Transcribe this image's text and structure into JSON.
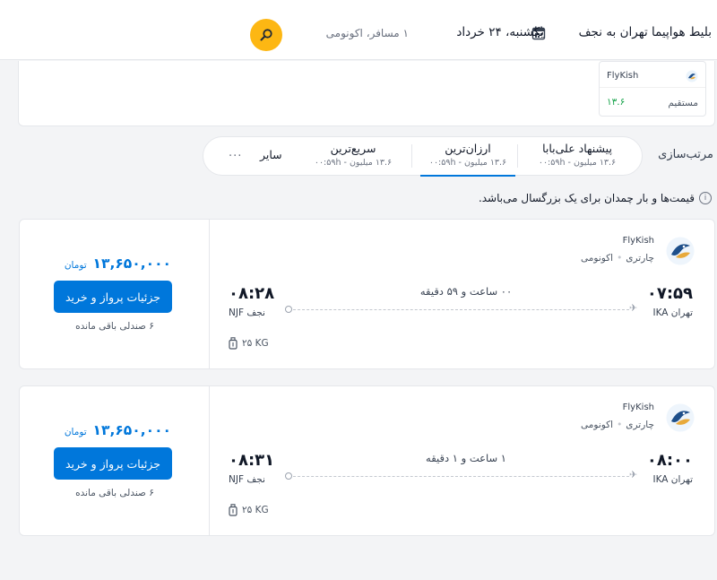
{
  "header": {
    "title": "بلیط هواپیما تهران به نجف",
    "date": "یکشنبه، ۲۴ خرداد",
    "passengers": "۱ مسافر، اکونومی"
  },
  "airline_summary": {
    "name": "FlyKish",
    "stop_type": "مستقیم",
    "price": "۱۳.۶"
  },
  "sort": {
    "label": "مرتب‌سازی",
    "options": [
      {
        "title": "پیشنهاد علی‌بابا",
        "sub": "۱۳.۶ میلیون - ۰۰:۵۹h"
      },
      {
        "title": "ارزان‌ترین",
        "sub": "۱۳.۶ میلیون - ۰۰:۵۹h"
      },
      {
        "title": "سریع‌ترین",
        "sub": "۱۳.۶ میلیون - ۰۰:۵۹h"
      }
    ],
    "other": "سایر",
    "more": "..."
  },
  "note": "قیمت‌ها و بار چمدان برای یک بزرگسال می‌باشد.",
  "flights": [
    {
      "airline": "FlyKish",
      "class": "اکونومی",
      "type": "چارتری",
      "dep_time": "۰۷:۵۹",
      "dep_city": "تهران IKA",
      "arr_time": "۰۸:۲۸",
      "arr_city": "نجف NJF",
      "duration": "۰۰ ساعت و ۵۹ دقیقه",
      "baggage": "۲۵ KG",
      "price": "۱۳,۶۵۰,۰۰۰",
      "currency": "تومان",
      "button": "جزئیات پرواز و خرید",
      "seats": "۶ صندلی باقی مانده"
    },
    {
      "airline": "FlyKish",
      "class": "اکونومی",
      "type": "چارتری",
      "dep_time": "۰۸:۰۰",
      "dep_city": "تهران IKA",
      "arr_time": "۰۸:۳۱",
      "arr_city": "نجف NJF",
      "duration": "۱ ساعت و ۱ دقیقه",
      "baggage": "۲۵ KG",
      "price": "۱۳,۶۵۰,۰۰۰",
      "currency": "تومان",
      "button": "جزئیات پرواز و خرید",
      "seats": "۶ صندلی باقی مانده"
    }
  ],
  "colors": {
    "accent": "#0077db",
    "search": "#fdb713",
    "green": "#16a34a"
  },
  "icons": [
    "calendar-icon",
    "search-icon",
    "airline-logo-icon",
    "info-icon",
    "plane-icon",
    "luggage-icon"
  ]
}
